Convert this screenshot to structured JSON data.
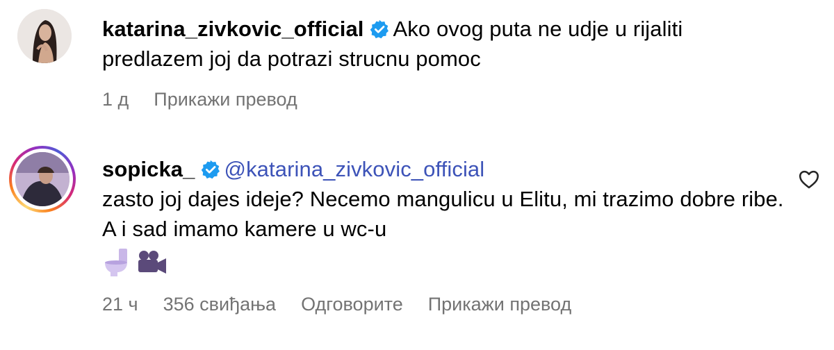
{
  "comments": [
    {
      "username": "katarina_zivkovic_official",
      "verified": true,
      "text": "Ako ovog puta ne udje u rijaliti predlazem joj da potrazi strucnu pomoc",
      "time": "1 д",
      "translate_label": "Прикажи превод"
    },
    {
      "username": "sopicka_",
      "verified": true,
      "mention": "@katarina_zivkovic_official",
      "text": "zasto joj dajes ideje? Necemo mangulicu u Elitu, mi trazimo dobre ribe. A i sad imamo kamere u wc-u",
      "emojis": [
        "toilet-icon",
        "video-camera-icon"
      ],
      "time": "21 ч",
      "likes": "356 свиђања",
      "reply_label": "Одговорите",
      "translate_label": "Прикажи превод"
    }
  ],
  "colors": {
    "verified": "#1d9bf0",
    "mention": "#3d53b8",
    "meta": "#737373"
  }
}
